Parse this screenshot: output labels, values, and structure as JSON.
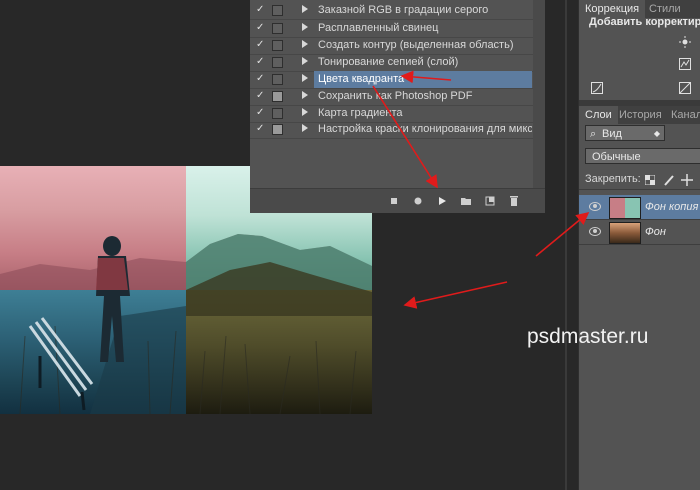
{
  "actions_panel": {
    "rows": [
      {
        "label": "Заказной RGB в градации серого",
        "check": "✓",
        "selected": false
      },
      {
        "label": "Расплавленный свинец",
        "check": "✓",
        "selected": false
      },
      {
        "label": "Создать контур (выделенная область)",
        "check": "✓",
        "selected": false
      },
      {
        "label": "Тонирование сепией (слой)",
        "check": "✓",
        "selected": false
      },
      {
        "label": "Цвета квадранта",
        "check": "✓",
        "selected": true
      },
      {
        "label": "Сохранить как Photoshop PDF",
        "check": "✓",
        "selected": false
      },
      {
        "label": "Карта градиента",
        "check": "✓",
        "selected": false
      },
      {
        "label": "Настройка краски клонирования для микс-к...",
        "check": "✓",
        "selected": false
      }
    ],
    "footer_icons": [
      "stop-icon",
      "record-icon",
      "play-icon",
      "folder-icon",
      "new-action-icon",
      "trash-icon"
    ]
  },
  "adjustments_panel": {
    "tabs": [
      "Коррекция",
      "Стили"
    ],
    "active_tab": "Коррекция",
    "title": "Добавить корректиров",
    "icons": [
      "brightness-icon",
      "levels-icon",
      "curves-icon",
      "exposure-icon"
    ]
  },
  "layers_panel": {
    "tabs": [
      "Слои",
      "История",
      "Канала"
    ],
    "active_tab": "Слои",
    "filter_label": "Вид",
    "blend_mode": "Обычные",
    "lock_label": "Закрепить:",
    "layers": [
      {
        "name": "Фон копия",
        "selected": true
      },
      {
        "name": "Фон",
        "selected": false
      }
    ]
  },
  "watermark": "psdmaster.ru",
  "colors": {
    "panel": "#535353",
    "selected": "#5d7ca0",
    "background": "#282828",
    "arrow": "#e01b1b"
  }
}
